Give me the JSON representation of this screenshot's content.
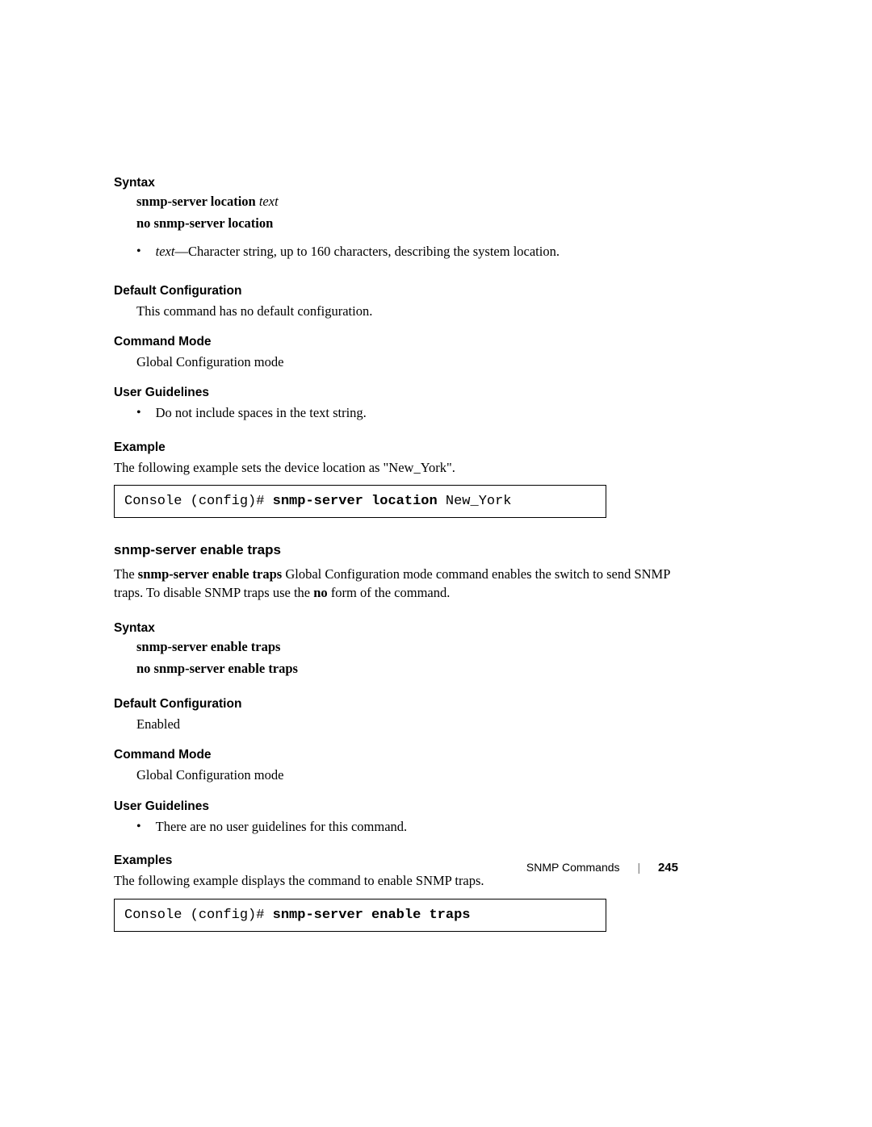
{
  "section1": {
    "syntax_heading": "Syntax",
    "line1_bold": "snmp-server location ",
    "line1_italic": "text",
    "line2_bold": "no snmp-server location",
    "bullet_italic": "text",
    "bullet_rest": "—Character string, up to 160 characters, describing the system location.",
    "default_heading": "Default Configuration",
    "default_text": "This command has no default configuration.",
    "mode_heading": "Command Mode",
    "mode_text": "Global Configuration mode",
    "guidelines_heading": "User Guidelines",
    "guidelines_bullet": "Do not include spaces in the text string.",
    "example_heading": "Example",
    "example_intro": "The following example sets the device location as \"New_York\".",
    "code_prefix": "Console (config)# ",
    "code_bold": "snmp-server location ",
    "code_suffix": "New_York"
  },
  "section2": {
    "title": "snmp-server enable traps",
    "desc_pre": "The ",
    "desc_bold1": "snmp-server enable traps",
    "desc_mid": " Global Configuration mode command enables the switch to send SNMP traps. To disable SNMP traps use the ",
    "desc_bold2": "no",
    "desc_post": " form of the command.",
    "syntax_heading": "Syntax",
    "line1_bold": "snmp-server enable traps",
    "line2_bold": "no snmp-server enable traps",
    "default_heading": "Default Configuration",
    "default_text": "Enabled",
    "mode_heading": "Command Mode",
    "mode_text": "Global Configuration mode",
    "guidelines_heading": "User Guidelines",
    "guidelines_bullet": "There are no user guidelines for this command.",
    "example_heading": "Examples",
    "example_intro": "The following example displays the command to enable SNMP traps.",
    "code_prefix": "Console (config)# ",
    "code_bold": "snmp-server enable traps"
  },
  "footer": {
    "chapter": "SNMP Commands",
    "page": "245"
  }
}
